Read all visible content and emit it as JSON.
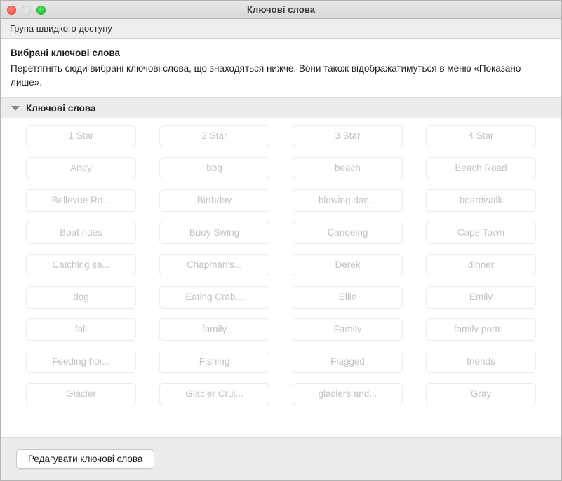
{
  "window": {
    "title": "Ключові слова",
    "controls": {
      "close": "close-button",
      "minimize": "minimize-button",
      "maximize": "maximize-button"
    }
  },
  "toolbar": {
    "group_label": "Група швидкого доступу"
  },
  "drop_area": {
    "title": "Вибрані ключові слова",
    "description": "Перетягніть сюди вибрані ключові слова, що знаходяться нижче. Вони також відображатимуться в меню «Показано лише»."
  },
  "section": {
    "title": "Ключові слова",
    "expanded": true,
    "disclosure_icon": "triangle-down-icon"
  },
  "keywords": [
    "1 Star",
    "2 Star",
    "3 Star",
    "4 Star",
    "Andy",
    "bbq",
    "beach",
    "Beach Road",
    "Bellevue Ro...",
    "Birthday",
    "blowing dan...",
    "boardwalk",
    "Boat rides",
    "Buoy Swing",
    "Canoeing",
    "Cape Town",
    "Catching sa...",
    "Chapman's...",
    "Derek",
    "dinner",
    "dog",
    "Eating Crab...",
    "Ellie",
    "Emily",
    "fall",
    "family",
    "Family",
    "family portr...",
    "Feeding hor...",
    "Fishing",
    "Flagged",
    "friends",
    "Glacier",
    "Glacier Crui...",
    "glaciers and...",
    "Gray"
  ],
  "footer": {
    "edit_button_label": "Редагувати ключові слова"
  },
  "colors": {
    "close": "#fb6058",
    "minimize": "#e3e3e3",
    "maximize": "#2ecb3c",
    "keyword_text": "#c3c3c3",
    "keyword_border": "#ebebeb",
    "section_bg": "#ececec"
  }
}
